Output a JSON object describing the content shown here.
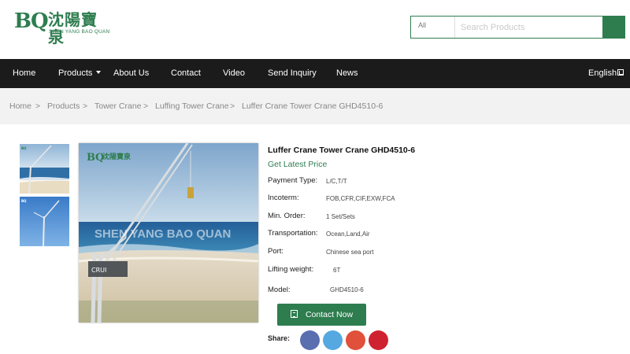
{
  "logo": {
    "mark": "BQ",
    "cn": "沈陽寶泉",
    "en": "SHEN YANG BAO QUAN"
  },
  "search": {
    "category": "All",
    "placeholder": "Search Products"
  },
  "nav": {
    "items": [
      {
        "label": "Home"
      },
      {
        "label": "Products"
      },
      {
        "label": "About Us"
      },
      {
        "label": "Contact"
      },
      {
        "label": "Video"
      },
      {
        "label": "Send Inquiry"
      },
      {
        "label": "News"
      }
    ],
    "language": "English"
  },
  "breadcrumb": [
    "Home",
    "Products",
    "Tower Crane",
    "Luffing Tower Crane",
    "Luffer Crane Tower Crane GHD4510-6"
  ],
  "breadcrumb_separator": ">",
  "product": {
    "title": "Luffer Crane Tower Crane GHD4510-6",
    "price_link": "Get Latest Price",
    "image_watermark": "SHEN YANG BAO QUAN",
    "image_logo_mark": "BQ",
    "image_logo_cn": "沈陽寶泉",
    "specs": [
      {
        "label": "Payment Type:",
        "value": "L/C,T/T"
      },
      {
        "label": "Incoterm:",
        "value": "FOB,CFR,CIF,EXW,FCA"
      },
      {
        "label": "Min. Order:",
        "value": "1 Set/Sets"
      },
      {
        "label": "Transportation:",
        "value": "Ocean,Land,Air"
      },
      {
        "label": "Port:",
        "value": "Chinese sea port"
      },
      {
        "label": "Lifting weight:",
        "value": "6T"
      },
      {
        "label": "Model:",
        "value": "GHD4510-6"
      }
    ],
    "contact_button": "Contact Now",
    "share_label": "Share:"
  },
  "share_buttons": [
    {
      "name": "facebook",
      "color": "#5a6fb0"
    },
    {
      "name": "twitter",
      "color": "#55a8e0"
    },
    {
      "name": "google-plus",
      "color": "#e0503a"
    },
    {
      "name": "pinterest",
      "color": "#cf2230"
    }
  ],
  "colors": {
    "brand": "#2e7d4f",
    "nav_bg": "#1b1b1b",
    "crumb_bg": "#f2f2f2"
  }
}
